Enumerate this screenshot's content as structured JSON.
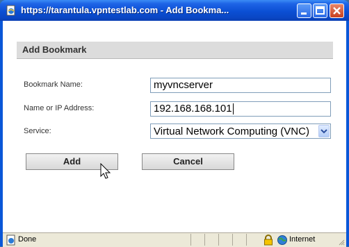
{
  "window": {
    "title": "https://tarantula.vpntestlab.com - Add Bookma..."
  },
  "dialog": {
    "header": "Add Bookmark",
    "fields": {
      "bookmark_name_label": "Bookmark Name:",
      "bookmark_name_value": "myvncserver",
      "address_label": "Name or IP Address:",
      "address_value": "192.168.168.101",
      "service_label": "Service:",
      "service_value": "Virtual Network Computing (VNC)"
    },
    "buttons": {
      "add": "Add",
      "cancel": "Cancel"
    }
  },
  "statusbar": {
    "status": "Done",
    "zone": "Internet"
  },
  "icons": [
    "ie-page-icon",
    "minimize-icon",
    "maximize-icon",
    "close-icon",
    "chevron-down-icon",
    "mouse-pointer-icon",
    "page-done-icon",
    "lock-icon",
    "globe-icon",
    "resize-grip-icon"
  ]
}
